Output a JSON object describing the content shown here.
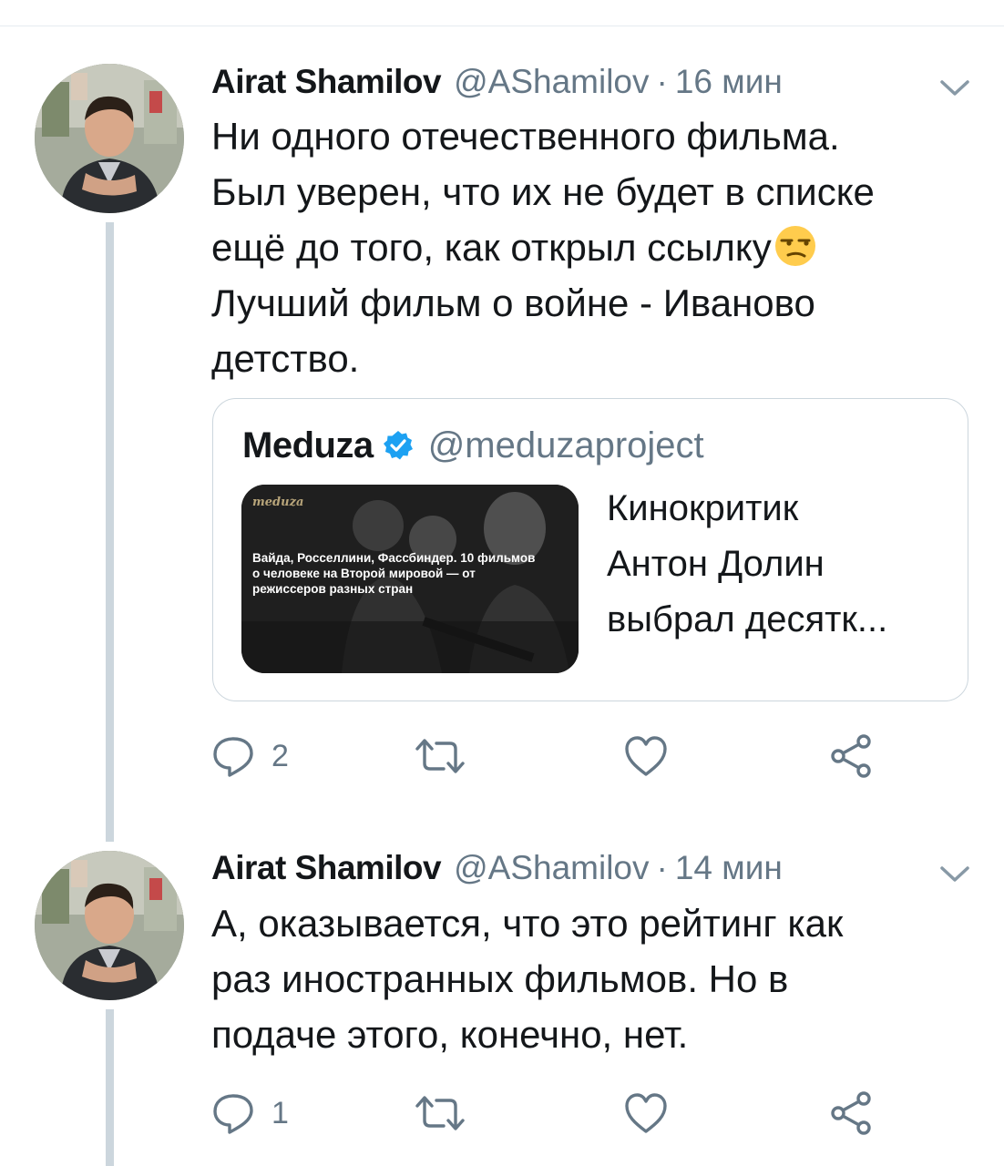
{
  "tweets": [
    {
      "author_name": "Airat Shamilov",
      "author_handle": "@AShamilov",
      "separator": "·",
      "time": "16 мин",
      "text": "Ни одного отечественного фильма.\nБыл уверен, что их не будет в списке\nещё до того, как открыл ссылку",
      "text_after_emoji": "\nЛучший фильм о войне - Иваново\nдетство.",
      "emoji": "unamused-face-icon",
      "quote": {
        "author_name": "Meduza",
        "author_handle": "@meduzaproject",
        "thumbnail_logo": "meduza",
        "thumbnail_caption": "Вайда, Росселлини, Фассбиндер. 10 фильмов о человеке на Второй мировой — от режиссеров разных стран",
        "text": "Кинокритик\nАнтон Долин\nвыбрал десятк..."
      },
      "reply_count": "2",
      "retweet_count": "",
      "like_count": ""
    },
    {
      "author_name": "Airat Shamilov",
      "author_handle": "@AShamilov",
      "separator": "·",
      "time": "14 мин",
      "text": "А, оказывается, что это рейтинг как\nраз иностранных фильмов. Но в\nподаче этого, конечно, нет.",
      "reply_count": "1",
      "retweet_count": "",
      "like_count": ""
    }
  ],
  "colors": {
    "text": "#14171a",
    "secondary": "#657786",
    "thread_line": "#ccd6dd",
    "verified": "#1da1f2"
  }
}
